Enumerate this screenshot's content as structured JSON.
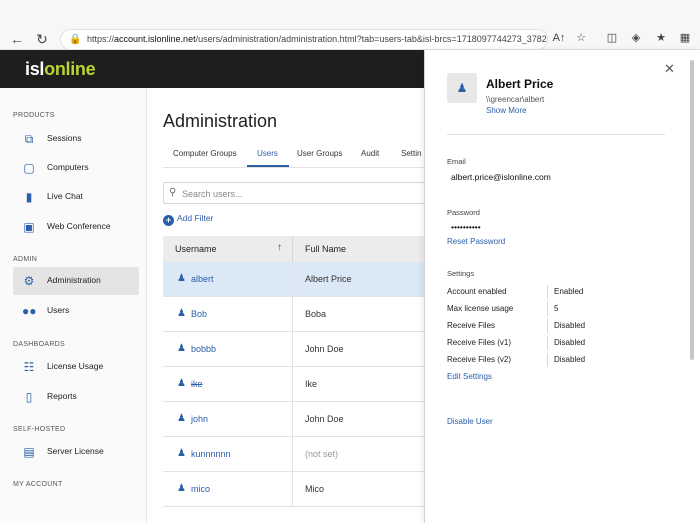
{
  "browser": {
    "url_prefix": "https://",
    "url_domain": "account.islonline.net",
    "url_rest": "/users/administration/administration.html?tab=users-tab&isl-brcs=1718097744273_37822&column..."
  },
  "app": {
    "logo_isl": "isl",
    "logo_online": "online"
  },
  "sidebar": {
    "sections": [
      {
        "label": "PRODUCTS"
      },
      {
        "label": "ADMIN"
      },
      {
        "label": "DASHBOARDS"
      },
      {
        "label": "SELF-HOSTED"
      },
      {
        "label": "MY ACCOUNT"
      }
    ],
    "items": [
      {
        "label": "Sessions",
        "icon": "sessions-icon"
      },
      {
        "label": "Computers",
        "icon": "computers-icon"
      },
      {
        "label": "Live Chat",
        "icon": "live-chat-icon"
      },
      {
        "label": "Web Conference",
        "icon": "web-conference-icon"
      },
      {
        "label": "Administration",
        "icon": "gear-icon"
      },
      {
        "label": "Users",
        "icon": "users-icon"
      },
      {
        "label": "License Usage",
        "icon": "license-usage-icon"
      },
      {
        "label": "Reports",
        "icon": "reports-icon"
      },
      {
        "label": "Server License",
        "icon": "server-license-icon"
      }
    ]
  },
  "main": {
    "title": "Administration",
    "tabs": [
      {
        "label": "Computer Groups"
      },
      {
        "label": "Users"
      },
      {
        "label": "User Groups"
      },
      {
        "label": "Audit"
      },
      {
        "label": "Settin"
      }
    ],
    "search_placeholder": "Search users...",
    "add_filter": "Add Filter",
    "columns": {
      "username": "Username",
      "full_name": "Full Name"
    },
    "rows": [
      {
        "username": "albert",
        "full_name": "Albert Price"
      },
      {
        "username": "Bob",
        "full_name": "Boba"
      },
      {
        "username": "bobbb",
        "full_name": "John Doe"
      },
      {
        "username": "ike",
        "full_name": "Ike"
      },
      {
        "username": "john",
        "full_name": "John Doe"
      },
      {
        "username": "kunnnnnn",
        "full_name": "(not set)"
      },
      {
        "username": "mico",
        "full_name": "Mico"
      }
    ]
  },
  "panel": {
    "name": "Albert Price",
    "domain": "\\\\greencar\\albert",
    "show_more": "Show More",
    "email_label": "Email",
    "email_value": "albert.price@islonline.com",
    "password_label": "Password",
    "password_value": "••••••••••",
    "reset_password": "Reset Password",
    "settings_label": "Settings",
    "settings": [
      {
        "key": "Account enabled",
        "value": "Enabled"
      },
      {
        "key": "Max license usage",
        "value": "5"
      },
      {
        "key": "Receive Files",
        "value": "Disabled"
      },
      {
        "key": "Receive Files (v1)",
        "value": "Disabled"
      },
      {
        "key": "Receive Files (v2)",
        "value": "Disabled"
      }
    ],
    "edit_settings": "Edit Settings",
    "disable_user": "Disable User"
  },
  "colors": {
    "accent": "#2b5fa8",
    "logo_green": "#b8d432",
    "topbar": "#1e1e1e",
    "selected_row": "#dbe8f5"
  }
}
